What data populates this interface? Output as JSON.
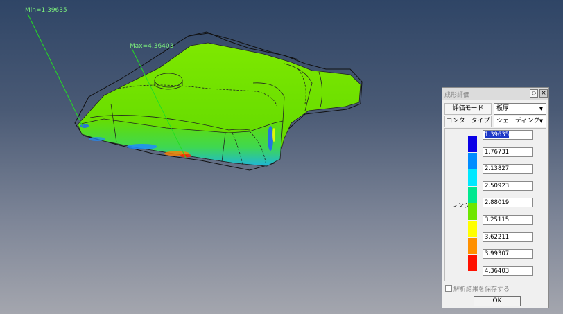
{
  "viewport": {
    "annotations": {
      "min_label": "Min=1.39635",
      "max_label": "Max=4.36403"
    }
  },
  "dialog": {
    "title": "成形評価",
    "eval_mode": {
      "label": "評価モード",
      "value": "板厚"
    },
    "contour_type": {
      "label": "コンタータイプ",
      "value": "シェーディング"
    },
    "range": {
      "label": "レンジ",
      "values": [
        "1.39635",
        "1.76731",
        "2.13827",
        "2.50923",
        "2.88019",
        "3.25115",
        "3.62211",
        "3.99307",
        "4.36403"
      ],
      "colors": [
        "#0a00e6",
        "#008cff",
        "#00e8ff",
        "#00e890",
        "#6ee600",
        "#ffff00",
        "#ff9000",
        "#ff1000"
      ]
    },
    "save_result_label": "解析結果を保存する",
    "ok_label": "OK"
  }
}
